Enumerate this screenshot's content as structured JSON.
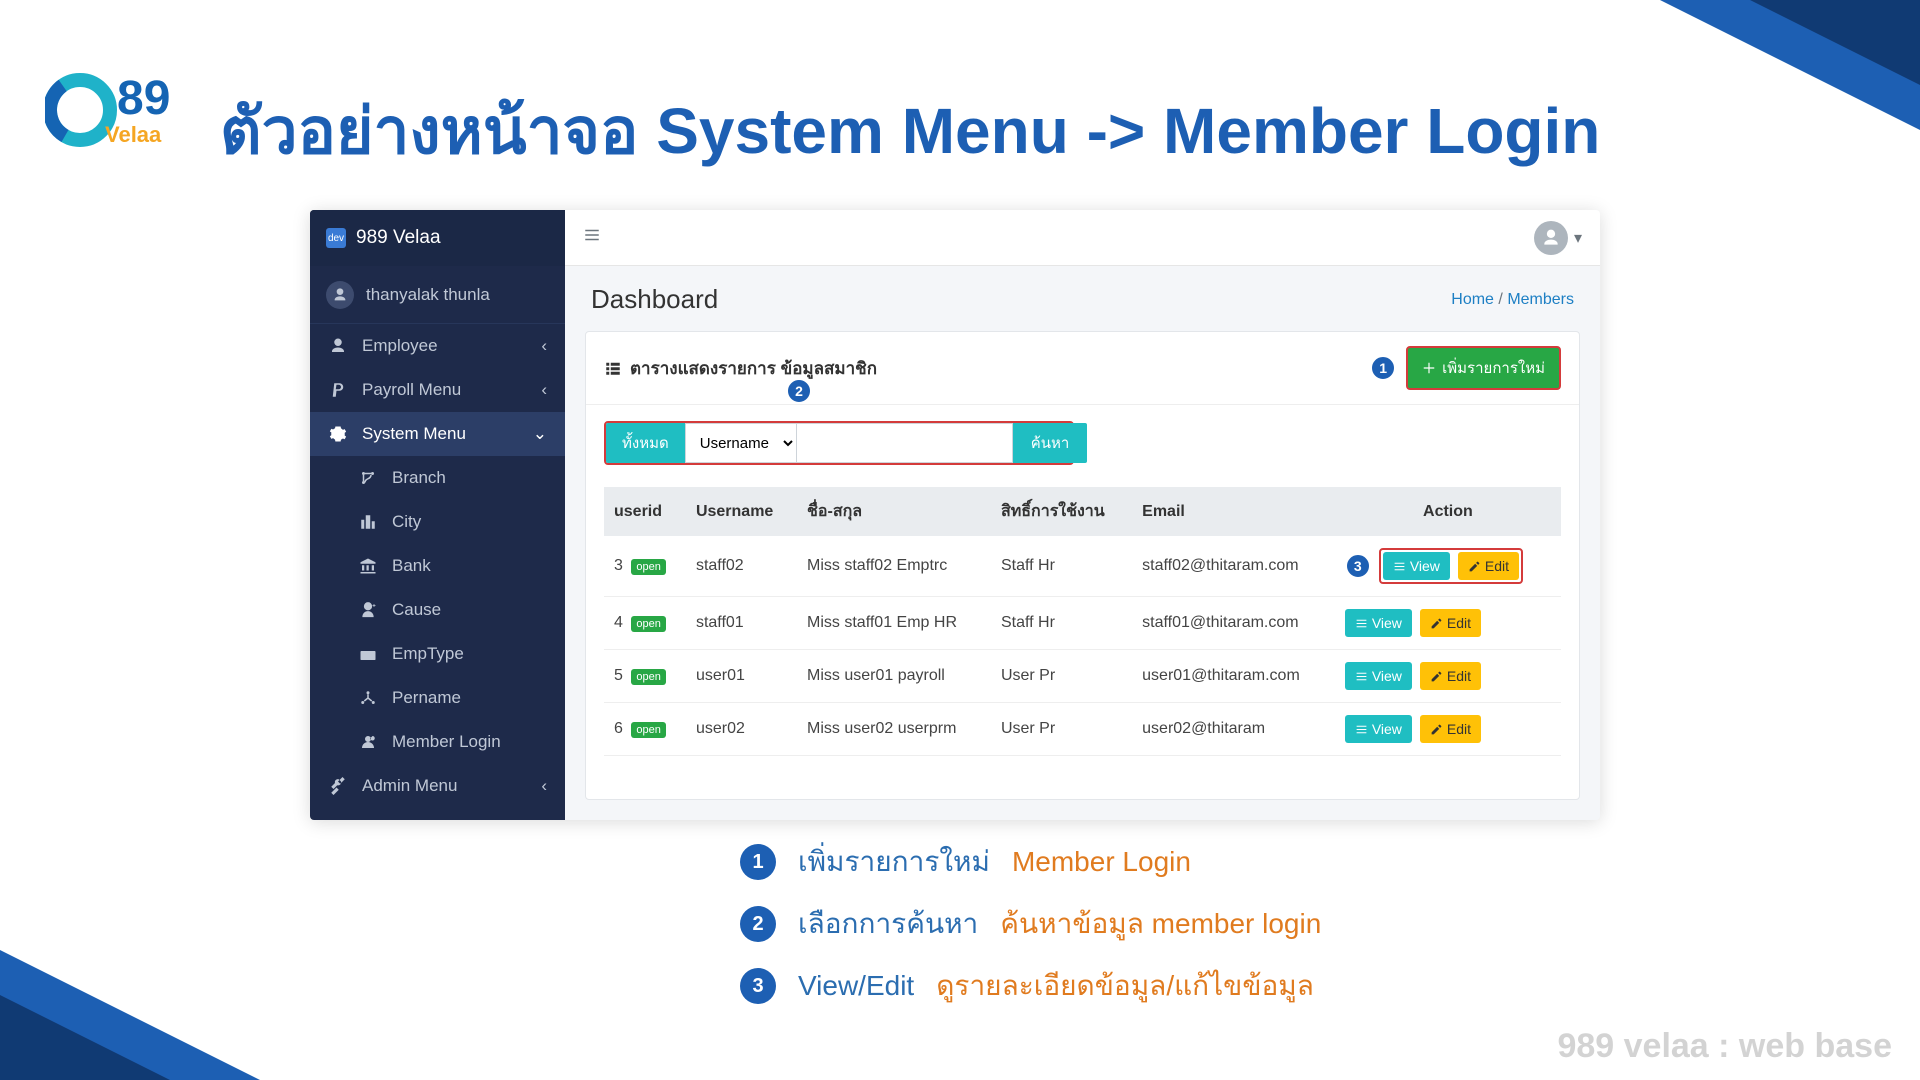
{
  "slide": {
    "title": "ตัวอย่างหน้าจอ System Menu -> Member Login",
    "watermark": "989 velaa : web base",
    "logo_top": "989",
    "logo_bottom": "Velaa"
  },
  "sidebar": {
    "brand": "989 Velaa",
    "user": "thanyalak thunla",
    "items": [
      {
        "icon": "person",
        "label": "Employee",
        "expandable": true
      },
      {
        "icon": "paypal",
        "label": "Payroll Menu",
        "expandable": true
      },
      {
        "icon": "gears",
        "label": "System Menu",
        "expandable": true,
        "active": true
      },
      {
        "icon": "branch",
        "label": "Branch",
        "sub": true
      },
      {
        "icon": "city",
        "label": "City",
        "sub": true
      },
      {
        "icon": "bank",
        "label": "Bank",
        "sub": true
      },
      {
        "icon": "cause",
        "label": "Cause",
        "sub": true
      },
      {
        "icon": "emptype",
        "label": "EmpType",
        "sub": true
      },
      {
        "icon": "pername",
        "label": "Pername",
        "sub": true
      },
      {
        "icon": "memberlogin",
        "label": "Member Login",
        "sub": true
      },
      {
        "icon": "tools",
        "label": "Admin Menu",
        "expandable": true
      }
    ]
  },
  "page": {
    "header": "Dashboard",
    "crumb_home": "Home",
    "crumb_sep": "/",
    "crumb_current": "Members",
    "card_title": "ตารางแสดงรายการ ข้อมูลสมาชิก",
    "add_button": "เพิ่มรายการใหม่",
    "search_all": "ทั้งหมด",
    "search_field": "Username",
    "search_go": "ค้นหา",
    "search_value": "",
    "badges": {
      "one": "1",
      "two": "2",
      "three": "3"
    },
    "cols": {
      "userid": "userid",
      "username": "Username",
      "fullname": "ชื่อ-สกุล",
      "role": "สิทธิ์การใช้งาน",
      "email": "Email",
      "action": "Action"
    },
    "status_label": "open",
    "view_label": "View",
    "edit_label": "Edit",
    "rows": [
      {
        "id": "3",
        "username": "staff02",
        "fullname": "Miss staff02 Emptrc",
        "role": "Staff Hr",
        "email": "staff02@thitaram.com",
        "highlight": true
      },
      {
        "id": "4",
        "username": "staff01",
        "fullname": "Miss staff01 Emp HR",
        "role": "Staff Hr",
        "email": "staff01@thitaram.com"
      },
      {
        "id": "5",
        "username": "user01",
        "fullname": "Miss user01 payroll",
        "role": "User Pr",
        "email": "user01@thitaram.com"
      },
      {
        "id": "6",
        "username": "user02",
        "fullname": "Miss user02 userprm",
        "role": "User Pr",
        "email": "user02@thitaram"
      }
    ]
  },
  "legend": {
    "r1": {
      "num": "1",
      "a": "เพิ่มรายการใหม่",
      "b": "Member Login"
    },
    "r2": {
      "num": "2",
      "a": "เลือกการค้นหา",
      "b": "ค้นหาข้อมูล member login"
    },
    "r3": {
      "num": "3",
      "a": "View/Edit",
      "b": "ดูรายละเอียดข้อมูล/แก้ไขข้อมูล"
    }
  }
}
